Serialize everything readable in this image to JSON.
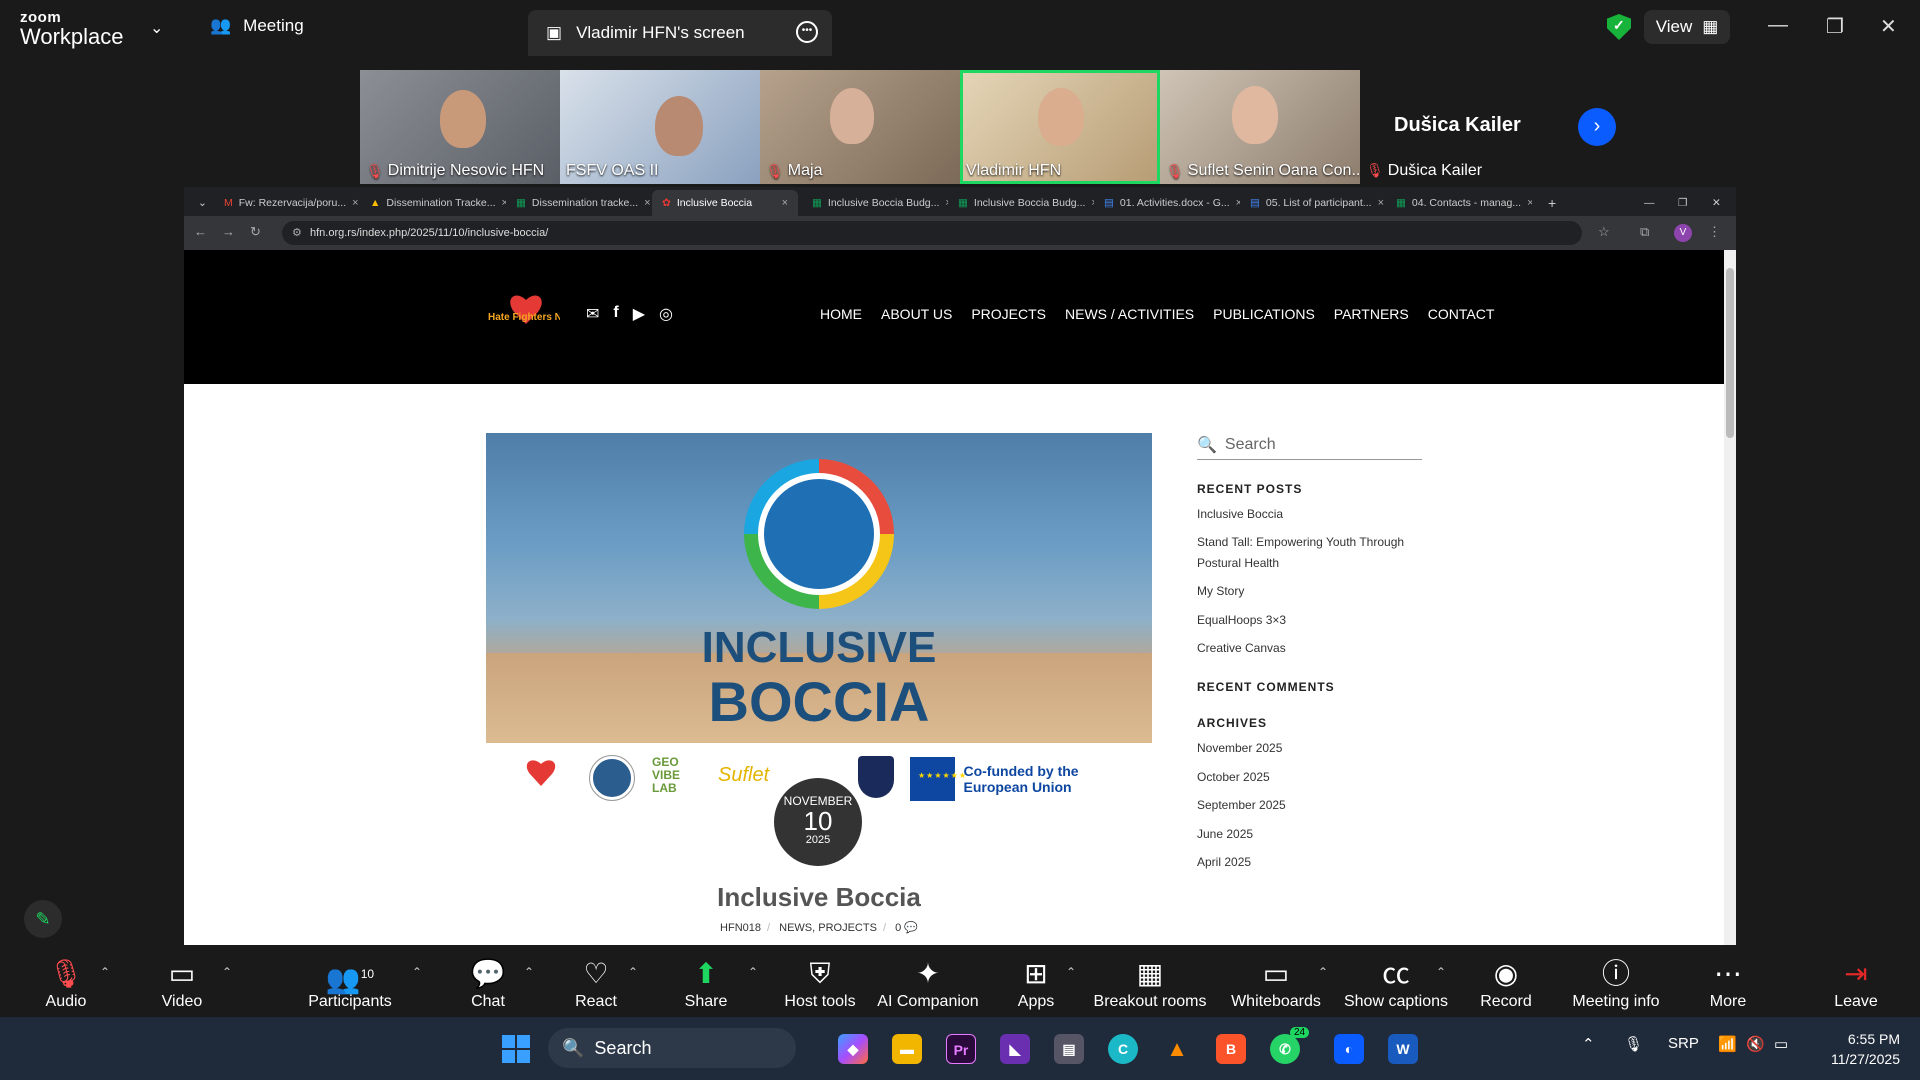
{
  "zoom": {
    "brand_top": "zoom",
    "brand_bottom": "Workplace",
    "meeting_tab": "Meeting",
    "screen_tab": "Vladimir HFN's screen",
    "view_label": "View"
  },
  "participants": [
    {
      "name": "Dimitrije Nesovic HFN",
      "muted": true
    },
    {
      "name": "FSFV OAS II",
      "muted": false
    },
    {
      "name": "Maja",
      "muted": true
    },
    {
      "name": "Vladimir HFN",
      "muted": false,
      "active": true
    },
    {
      "name": "Suflet Senin Oana Con...",
      "muted": true
    }
  ],
  "name_tile": {
    "big_name": "Dušica Kailer",
    "label": "Dušica Kailer"
  },
  "browser": {
    "tabs": [
      "Fw: Rezervacija/poru...",
      "Dissemination Tracke...",
      "Dissemination tracke...",
      "Inclusive Boccia",
      "Inclusive Boccia Budg...",
      "Inclusive Boccia Budg...",
      "01. Activities.docx - G...",
      "05. List of participant...",
      "04. Contacts - manag..."
    ],
    "url": "hfn.org.rs/index.php/2025/11/10/inclusive-boccia/",
    "profile_initial": "V"
  },
  "site": {
    "logo_text": "Hate Fighters Network",
    "nav": [
      "HOME",
      "ABOUT US",
      "PROJECTS",
      "NEWS / ACTIVITIES",
      "PUBLICATIONS",
      "PARTNERS",
      "CONTACT"
    ],
    "hero_line1": "INCLUSIVE",
    "hero_line2": "BOCCIA",
    "eu_text": "Co-funded by the European Union",
    "partner_logos": [
      "GEO VIBE LAB",
      "Suflet"
    ],
    "date": {
      "month": "NOVEMBER",
      "day": "10",
      "year": "2025"
    },
    "post_title": "Inclusive Boccia",
    "post_meta": {
      "author": "HFN018",
      "cat1": "NEWS",
      "cat2": "PROJECTS",
      "comments": "0"
    },
    "search_placeholder": "Search",
    "recent_posts_heading": "RECENT POSTS",
    "recent_posts": [
      "Inclusive Boccia",
      "Stand Tall: Empowering Youth Through Postural Health",
      "My Story",
      "EqualHoops 3×3",
      "Creative Canvas"
    ],
    "recent_comments_heading": "RECENT COMMENTS",
    "archives_heading": "ARCHIVES",
    "archives": [
      "November 2025",
      "October 2025",
      "September 2025",
      "June 2025",
      "April 2025"
    ]
  },
  "toolbar": [
    {
      "label": "Audio"
    },
    {
      "label": "Video"
    },
    {
      "label": "Participants",
      "badge": "10"
    },
    {
      "label": "Chat"
    },
    {
      "label": "React"
    },
    {
      "label": "Share"
    },
    {
      "label": "Host tools"
    },
    {
      "label": "AI Companion"
    },
    {
      "label": "Apps"
    },
    {
      "label": "Breakout rooms"
    },
    {
      "label": "Whiteboards"
    },
    {
      "label": "Show captions"
    },
    {
      "label": "Record"
    },
    {
      "label": "Meeting info"
    },
    {
      "label": "More"
    },
    {
      "label": "Leave"
    }
  ],
  "taskbar": {
    "search": "Search",
    "whatsapp_badge": "24",
    "lang": "SRP",
    "time": "6:55 PM",
    "date": "11/27/2025"
  },
  "colors": {
    "accent_green": "#1ed760",
    "zoom_blue": "#0b5cff",
    "leave_red": "#e02828"
  }
}
